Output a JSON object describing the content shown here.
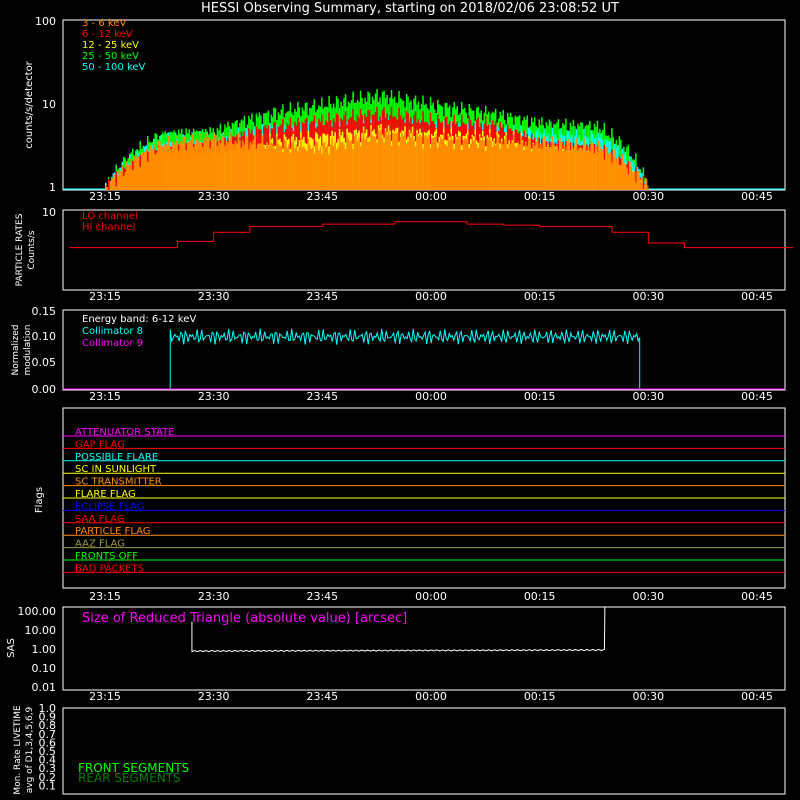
{
  "chart_data": [
    {
      "type": "bar",
      "title": "HESSI Observing Summary, starting on 2018/02/06 23:08:52 UT",
      "ylabel": "counts/s/detector",
      "y_scale": "log",
      "ylim": [
        1,
        100
      ],
      "y_ticks": [
        "1",
        "10",
        "100"
      ],
      "x_ticks": [
        "23:15",
        "23:30",
        "23:45",
        "00:00",
        "00:15",
        "00:30",
        "00:45"
      ],
      "series": [
        {
          "name": "3 - 6 keV",
          "color": "#ff8c00",
          "values": [
            1,
            3.5,
            4,
            3.5,
            3.2,
            4.5,
            4,
            3.8,
            3.5,
            3.2,
            1
          ]
        },
        {
          "name": "6 - 12 keV",
          "color": "#ff0000",
          "values": [
            1,
            2.8,
            3.2,
            5.5,
            6.5,
            8,
            6.5,
            6,
            3.5,
            3,
            1
          ]
        },
        {
          "name": "12 - 25 keV",
          "color": "#ffff00",
          "values": [
            1,
            2.5,
            2.8,
            3.8,
            4.2,
            5,
            4.5,
            4.2,
            3.5,
            3,
            1
          ]
        },
        {
          "name": "25 - 50 keV",
          "color": "#00ff00",
          "values": [
            1,
            4.5,
            4.8,
            8,
            10,
            13,
            10,
            8,
            6,
            5.5,
            1
          ]
        },
        {
          "name": "50 - 100 keV",
          "color": "#00ffff",
          "values": [
            1,
            3.8,
            4,
            5,
            5.5,
            6,
            5.5,
            5,
            4.5,
            4.2,
            1
          ]
        }
      ],
      "x": [
        "23:15",
        "23:23",
        "23:30",
        "23:38",
        "23:45",
        "23:53",
        "00:00",
        "00:08",
        "00:15",
        "00:23",
        "00:30"
      ]
    },
    {
      "type": "line",
      "ylabel": "PARTICLE RATES Counts/s",
      "y_scale": "log",
      "y_ticks": [
        "10"
      ],
      "x_ticks": [
        "23:15",
        "23:30",
        "23:45",
        "00:00",
        "00:15",
        "00:30",
        "00:45"
      ],
      "series": [
        {
          "name": "LO channel",
          "color": "#ff0000",
          "values": []
        },
        {
          "name": "HI channel",
          "color": "#ff0000",
          "x": [
            "23:10",
            "23:15",
            "23:20",
            "23:25",
            "23:30",
            "23:35",
            "23:40",
            "23:45",
            "23:50",
            "23:55",
            "00:00",
            "00:05",
            "00:10",
            "00:15",
            "00:20",
            "00:25",
            "00:30",
            "00:35",
            "00:40",
            "00:45",
            "00:50"
          ],
          "values": [
            3.5,
            3.5,
            3.5,
            4.2,
            5.5,
            6.5,
            6.5,
            7,
            7,
            7.5,
            7.5,
            7,
            6.8,
            6.5,
            6.5,
            5.5,
            4,
            3.5,
            3.5,
            3.5,
            3.5
          ]
        }
      ]
    },
    {
      "type": "line",
      "ylabel": "Normalized modulation",
      "ylim": [
        0,
        0.15
      ],
      "y_ticks": [
        "0.00",
        "0.05",
        "0.10",
        "0.15"
      ],
      "x_ticks": [
        "23:15",
        "23:30",
        "23:45",
        "00:00",
        "00:15",
        "00:30",
        "00:45"
      ],
      "annotation": "Energy band: 6-12 keV",
      "series": [
        {
          "name": "Collimator 8",
          "color": "#00ffff",
          "x": [
            "23:24",
            "23:30",
            "23:45",
            "00:00",
            "00:15",
            "00:29"
          ],
          "values": [
            0.1,
            0.1,
            0.1,
            0.1,
            0.1,
            0.1
          ]
        },
        {
          "name": "Collimator 9",
          "color": "#ff00ff",
          "values": [
            0,
            0
          ]
        }
      ]
    },
    {
      "type": "line",
      "ylabel": "Flags",
      "x_ticks": [
        "23:15",
        "23:30",
        "23:45",
        "00:00",
        "00:15",
        "00:30",
        "00:45"
      ],
      "flags": [
        {
          "name": "ATTENUATOR STATE",
          "color": "#ff00ff"
        },
        {
          "name": "GAP FLAG",
          "color": "#ff0000"
        },
        {
          "name": "POSSIBLE FLARE",
          "color": "#00ffff"
        },
        {
          "name": "SC IN SUNLIGHT",
          "color": "#ffff00"
        },
        {
          "name": "SC TRANSMITTER",
          "color": "#ff8c00"
        },
        {
          "name": "FLARE FLAG",
          "color": "#ffff00"
        },
        {
          "name": "ECLIPSE FLAG",
          "color": "#0000ff"
        },
        {
          "name": "SAA FLAG",
          "color": "#ff0000"
        },
        {
          "name": "PARTICLE FLAG",
          "color": "#ff8c00"
        },
        {
          "name": "AAZ FLAG",
          "color": "#9a9a3c"
        },
        {
          "name": "FRONTS OFF",
          "color": "#00ff00"
        },
        {
          "name": "BAD PACKETS",
          "color": "#ff0000"
        }
      ]
    },
    {
      "type": "line",
      "ylabel": "SAS",
      "y_scale": "log",
      "ylim": [
        0.01,
        100
      ],
      "y_ticks": [
        "0.01",
        "0.10",
        "1.00",
        "10.00",
        "100.00"
      ],
      "x_ticks": [
        "23:15",
        "23:30",
        "23:45",
        "00:00",
        "00:15",
        "00:30",
        "00:45"
      ],
      "series": [
        {
          "name": "Size of Reduced Triangle (absolute value) [arcsec]",
          "color": "#ffffff",
          "x": [
            "23:27",
            "23:30",
            "23:45",
            "00:00",
            "00:15",
            "00:24"
          ],
          "values": [
            0.75,
            0.72,
            0.78,
            0.8,
            0.82,
            0.85
          ]
        }
      ]
    },
    {
      "type": "line",
      "ylabel": "Mon. Rate LIVETIME avg of D1,3,4,5,6,9",
      "ylim": [
        0,
        1
      ],
      "y_ticks": [
        "0.1",
        "0.2",
        "0.3",
        "0.4",
        "0.5",
        "0.6",
        "0.7",
        "0.8",
        "0.9",
        "1.0"
      ],
      "series": [
        {
          "name": "FRONT SEGMENTS",
          "color": "#00ff00",
          "values": []
        },
        {
          "name": "REAR SEGMENTS",
          "color": "#008000",
          "values": []
        }
      ]
    }
  ]
}
